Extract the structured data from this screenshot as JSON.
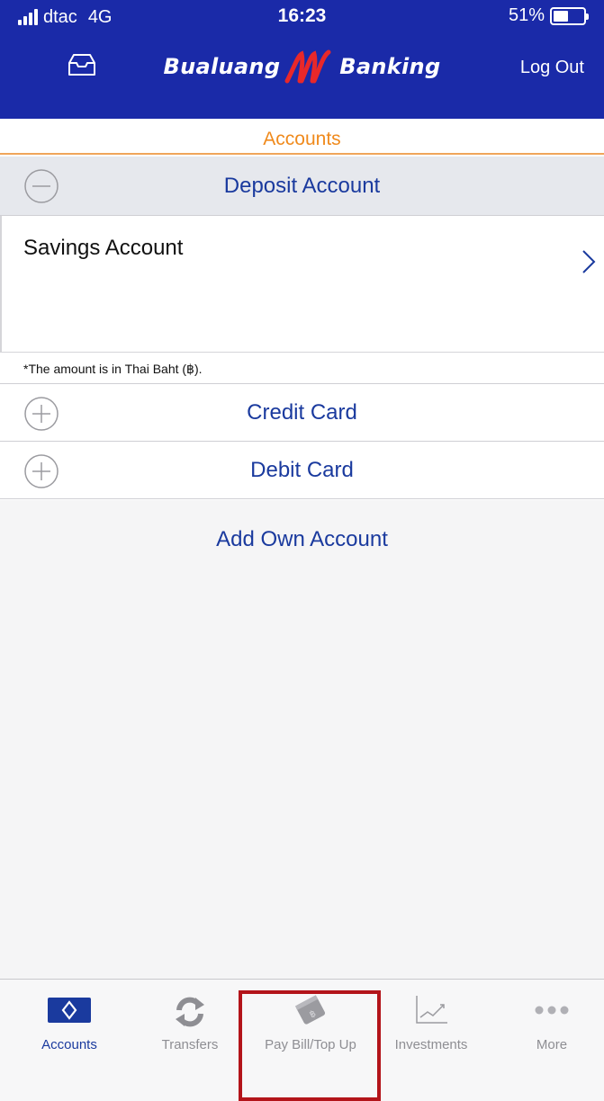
{
  "status_bar": {
    "carrier": "dtac",
    "network": "4G",
    "time": "16:23",
    "battery_text": "51%",
    "battery_level": 0.51
  },
  "nav": {
    "brand_left": "Bualuang",
    "brand_right": "Banking",
    "logout_label": "Log Out",
    "inbox_icon": "inbox-icon"
  },
  "section": {
    "title": "Accounts"
  },
  "accounts": {
    "deposit": {
      "label": "Deposit Account",
      "state": "expanded",
      "icon": "minus-circle-icon"
    },
    "savings": {
      "label": "Savings Account",
      "icon": "chevron-right-icon"
    },
    "note": "*The amount is in Thai Baht (฿).",
    "credit": {
      "label": "Credit Card",
      "state": "collapsed",
      "icon": "plus-circle-icon"
    },
    "debit": {
      "label": "Debit Card",
      "state": "collapsed",
      "icon": "plus-circle-icon"
    },
    "add_own_label": "Add Own Account"
  },
  "tabs": [
    {
      "label": "Accounts",
      "icon": "accounts-card-icon",
      "active": true
    },
    {
      "label": "Transfers",
      "icon": "transfer-arrows-icon",
      "active": false
    },
    {
      "label": "Pay Bill/Top Up",
      "icon": "pay-bill-icon",
      "active": false
    },
    {
      "label": "Investments",
      "icon": "investment-chart-icon",
      "active": false
    },
    {
      "label": "More",
      "icon": "more-dots-icon",
      "active": false
    }
  ],
  "colors": {
    "header_bg": "#1a2aa8",
    "accent_orange": "#f08a1c",
    "link_blue": "#1a3a9e",
    "highlight_red": "#b3141a",
    "brand_red": "#e8282a"
  }
}
